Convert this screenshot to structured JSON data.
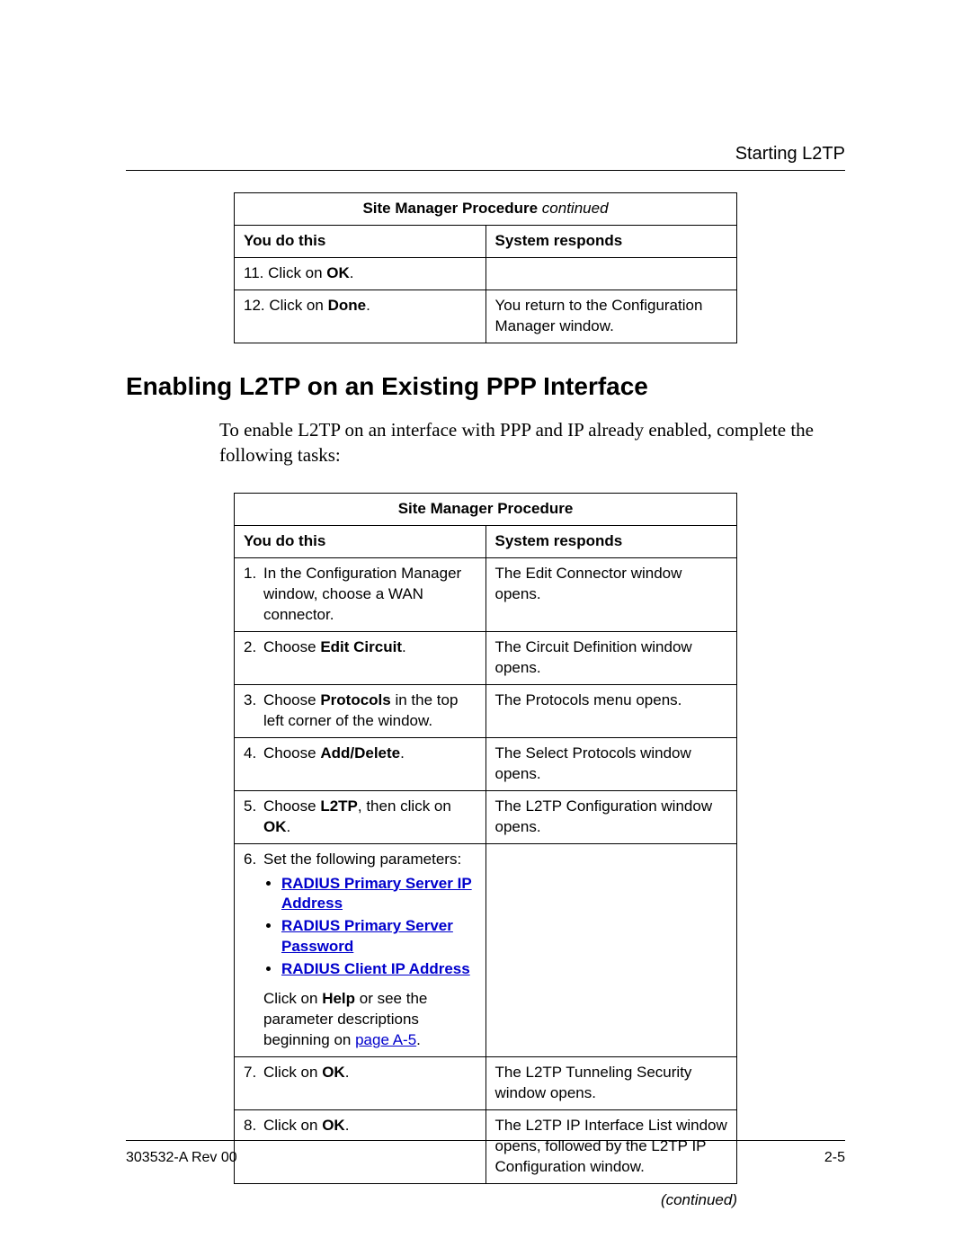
{
  "running_head": "Starting L2TP",
  "table1": {
    "title_prefix": "Site Manager Procedure",
    "title_suffix": " continued",
    "col_left": "You do this",
    "col_right": "System responds",
    "r1_num": "11.",
    "r1_text_a": "Click on ",
    "r1_bold": "OK",
    "r1_text_b": ".",
    "r1_resp": "",
    "r2_num": "12.",
    "r2_text_a": "Click on ",
    "r2_bold": "Done",
    "r2_text_b": ".",
    "r2_resp": "You return to the Configuration Manager window."
  },
  "section_heading": "Enabling L2TP on an Existing PPP Interface",
  "intro": "To enable L2TP on an interface with PPP and IP already enabled, complete the following tasks:",
  "table2": {
    "title": "Site Manager Procedure",
    "col_left": "You do this",
    "col_right": "System responds",
    "s1_num": "1.",
    "s1_text": "In the Configuration Manager window, choose a WAN connector.",
    "s1_resp": "The Edit Connector window opens.",
    "s2_num": "2.",
    "s2_text_a": "Choose ",
    "s2_bold": "Edit Circuit",
    "s2_text_b": ".",
    "s2_resp": "The Circuit Definition window opens.",
    "s3_num": "3.",
    "s3_text_a": "Choose ",
    "s3_bold": "Protocols",
    "s3_text_b": " in the top left corner of the window.",
    "s3_resp": "The Protocols menu opens.",
    "s4_num": "4.",
    "s4_text_a": "Choose ",
    "s4_bold": "Add/Delete",
    "s4_text_b": ".",
    "s4_resp": "The Select Protocols window opens.",
    "s5_num": "5.",
    "s5_text_a": "Choose ",
    "s5_bold": "L2TP",
    "s5_text_b": ", then click on ",
    "s5_bold2": "OK",
    "s5_text_c": ".",
    "s5_resp": "The L2TP Configuration window opens.",
    "s6_num": "6.",
    "s6_lead": "Set the following parameters:",
    "s6_link1": "RADIUS Primary Server IP Address",
    "s6_link2": "RADIUS Primary Server Password",
    "s6_link3": "RADIUS Client IP Address",
    "s6_tail_a": "Click on ",
    "s6_bold": "Help",
    "s6_tail_b": " or see the parameter descriptions beginning on ",
    "s6_pagelink": "page A-5",
    "s6_tail_c": ".",
    "s6_resp": "",
    "s7_num": "7.",
    "s7_text_a": "Click on ",
    "s7_bold": "OK",
    "s7_text_b": ".",
    "s7_resp": "The L2TP Tunneling Security window opens.",
    "s8_num": "8.",
    "s8_text_a": "Click on ",
    "s8_bold": "OK",
    "s8_text_b": ".",
    "s8_resp": "The L2TP IP Interface List window opens, followed by the L2TP IP Configuration window."
  },
  "continued": "(continued)",
  "footer_left": "303532-A Rev 00",
  "footer_right": "2-5"
}
